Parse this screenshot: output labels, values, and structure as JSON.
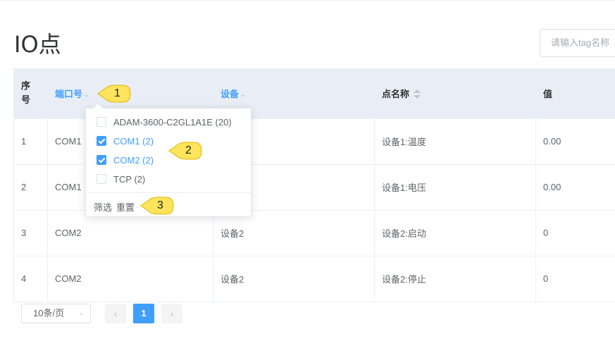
{
  "page": {
    "title": "IO点"
  },
  "search": {
    "placeholder": "请输入tag名称"
  },
  "table": {
    "headers": {
      "seq_line1": "序",
      "seq_line2": "号",
      "port": "端口号",
      "device": "设备",
      "point_name": "点名称",
      "value": "值"
    },
    "rows": [
      {
        "seq": "1",
        "port": "COM1",
        "device": "",
        "point_name": "设备1:温度",
        "value": "0.00"
      },
      {
        "seq": "2",
        "port": "COM1",
        "device": "",
        "point_name": "设备1:电压",
        "value": "0.00"
      },
      {
        "seq": "3",
        "port": "COM2",
        "device": "设备2",
        "point_name": "设备2:启动",
        "value": "0"
      },
      {
        "seq": "4",
        "port": "COM2",
        "device": "设备2",
        "point_name": "设备2:停止",
        "value": "0"
      }
    ]
  },
  "filter_dropdown": {
    "options": [
      {
        "label": "ADAM-3600-C2GL1A1E (20)",
        "checked": false
      },
      {
        "label": "COM1 (2)",
        "checked": true
      },
      {
        "label": "COM2 (2)",
        "checked": true
      },
      {
        "label": "TCP (2)",
        "checked": false
      }
    ],
    "confirm_label": "筛选",
    "reset_label": "重置"
  },
  "callouts": [
    "1",
    "2",
    "3"
  ],
  "pagination": {
    "page_size": "10条/页",
    "prev_icon": "chevron-left-icon",
    "next_icon": "chevron-right-icon",
    "current_page": "1"
  },
  "colors": {
    "accent": "#409eff",
    "header_bg": "#e9eef6",
    "callout_fill": "#ffe45c"
  }
}
